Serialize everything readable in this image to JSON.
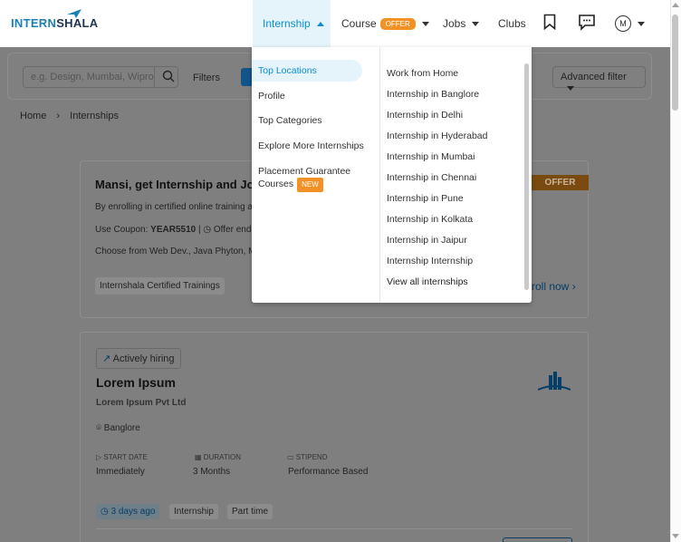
{
  "header": {
    "logo_text_a": "INTERN",
    "logo_text_b": "SHALA",
    "nav": {
      "internship": "Internship",
      "course": "Course",
      "course_badge": "OFFER",
      "jobs": "Jobs",
      "clubs": "Clubs"
    },
    "avatar_initial": "M"
  },
  "dropdown": {
    "categories": [
      {
        "label": "Top Locations"
      },
      {
        "label": "Profile"
      },
      {
        "label": "Top Categories"
      },
      {
        "label": "Explore More Internships"
      },
      {
        "label_line1": "Placement Guarantee",
        "label_line2": "Courses",
        "badge": "NEW"
      }
    ],
    "links": [
      "Work from Home",
      "Internship in Banglore",
      "Internship in Delhi",
      "Internship in Hyderabad",
      "Internship in Mumbai",
      "Internship in Chennai",
      "Internship in Pune",
      "Internship in Kolkata",
      "Internship in Jaipur",
      "Internship Internship",
      "View all internships"
    ]
  },
  "search": {
    "placeholder": "e.g. Design, Mumbai, Wipro",
    "filters_label": "Filters",
    "advanced_filter": "Advanced filter"
  },
  "breadcrumb": {
    "home": "Home",
    "current": "Internships"
  },
  "promo": {
    "title": "Mansi, get Internship and Jo",
    "line1": "By enrolling in certified online training a",
    "coupon_prefix": "Use Coupon:",
    "coupon_code": "YEAR5510",
    "offer_ends": "Offer ends",
    "line3": "Choose from Web Dev., Java Phyton, M",
    "tag": "Internshala Certified Trainings",
    "offer_strip": "OFFER",
    "enroll": "roll now"
  },
  "job": {
    "hiring_label": "Actively hiring",
    "title": "Lorem Ipsum",
    "company": "Lorem Ipsum Pvt Ltd",
    "location": "Banglore",
    "start_date_label": "START DATE",
    "start_date": "Immediately",
    "duration_label": "DURATION",
    "duration": "3 Months",
    "stipend_label": "STIPEND",
    "stipend": "Performance Based",
    "posted": "3 days ago",
    "type": "Internship",
    "schedule": "Part time"
  },
  "colors": {
    "accent": "#0a8ed6",
    "offer": "#f29226",
    "overlay": "#7f7f7f"
  }
}
